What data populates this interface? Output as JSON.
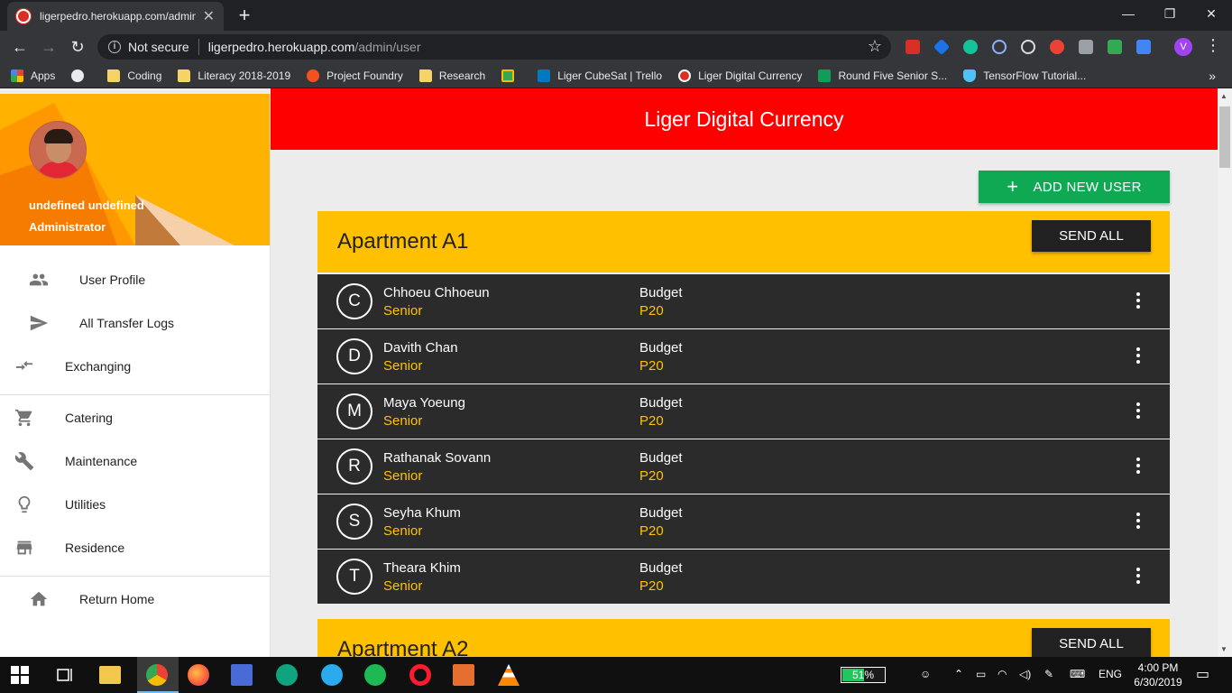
{
  "browser": {
    "tab_title": "ligerpedro.herokuapp.com/admin/user",
    "omnibox": {
      "security": "Not secure",
      "host": "ligerpedro.herokuapp.com",
      "path": "/admin/user"
    },
    "profile_initial": "V",
    "bookmarks": [
      {
        "label": "Apps",
        "icon": "apps-grid-icon"
      },
      {
        "label": "",
        "icon": "globe-icon"
      },
      {
        "label": "Coding",
        "icon": "folder-icon"
      },
      {
        "label": "Literacy 2018-2019",
        "icon": "folder-icon"
      },
      {
        "label": "Project Foundry",
        "icon": "foundry-icon"
      },
      {
        "label": "Research",
        "icon": "folder-icon"
      },
      {
        "label": "",
        "icon": "google-classroom-icon"
      },
      {
        "label": "Liger CubeSat | Trello",
        "icon": "trello-icon"
      },
      {
        "label": "Liger Digital Currency",
        "icon": "currency-site-icon"
      },
      {
        "label": "Round Five Senior S...",
        "icon": "sheets-icon"
      },
      {
        "label": "TensorFlow Tutorial...",
        "icon": "shield-icon"
      }
    ]
  },
  "sidebar": {
    "user_name": "undefined undefined",
    "user_role": "Administrator",
    "items": [
      {
        "label": "User Profile",
        "icon": "people-icon"
      },
      {
        "label": "All Transfer Logs",
        "icon": "send-icon"
      },
      {
        "label": "Exchanging",
        "icon": "swap-arrows-icon"
      },
      {
        "label": "Catering",
        "icon": "cart-icon"
      },
      {
        "label": "Maintenance",
        "icon": "wrench-icon"
      },
      {
        "label": "Utilities",
        "icon": "lightbulb-icon"
      },
      {
        "label": "Residence",
        "icon": "store-icon"
      },
      {
        "label": "Return Home",
        "icon": "home-icon"
      }
    ]
  },
  "appbar": {
    "title": "Liger Digital Currency"
  },
  "actions": {
    "add_user": "ADD NEW USER"
  },
  "apartments": [
    {
      "name": "Apartment A1",
      "send_all": "SEND ALL",
      "residents": [
        {
          "initial": "C",
          "name": "Chhoeu Chhoeun",
          "role": "Senior",
          "budget_label": "Budget",
          "budget": "P20"
        },
        {
          "initial": "D",
          "name": "Davith Chan",
          "role": "Senior",
          "budget_label": "Budget",
          "budget": "P20"
        },
        {
          "initial": "M",
          "name": "Maya Yoeung",
          "role": "Senior",
          "budget_label": "Budget",
          "budget": "P20"
        },
        {
          "initial": "R",
          "name": "Rathanak Sovann",
          "role": "Senior",
          "budget_label": "Budget",
          "budget": "P20"
        },
        {
          "initial": "S",
          "name": "Seyha Khum",
          "role": "Senior",
          "budget_label": "Budget",
          "budget": "P20"
        },
        {
          "initial": "T",
          "name": "Theara Khim",
          "role": "Senior",
          "budget_label": "Budget",
          "budget": "P20"
        }
      ]
    },
    {
      "name": "Apartment A2",
      "send_all": "SEND ALL",
      "residents": []
    }
  ],
  "taskbar": {
    "battery_percent": "51",
    "battery_level": 0.51,
    "language": "ENG",
    "time": "4:00 PM",
    "date": "6/30/2019"
  },
  "colors": {
    "appbar": "#fe0000",
    "apartment_header": "#ffc000",
    "accent_text": "#ffc107",
    "add_button": "#0fa954",
    "row_background": "#2b2b2b"
  }
}
